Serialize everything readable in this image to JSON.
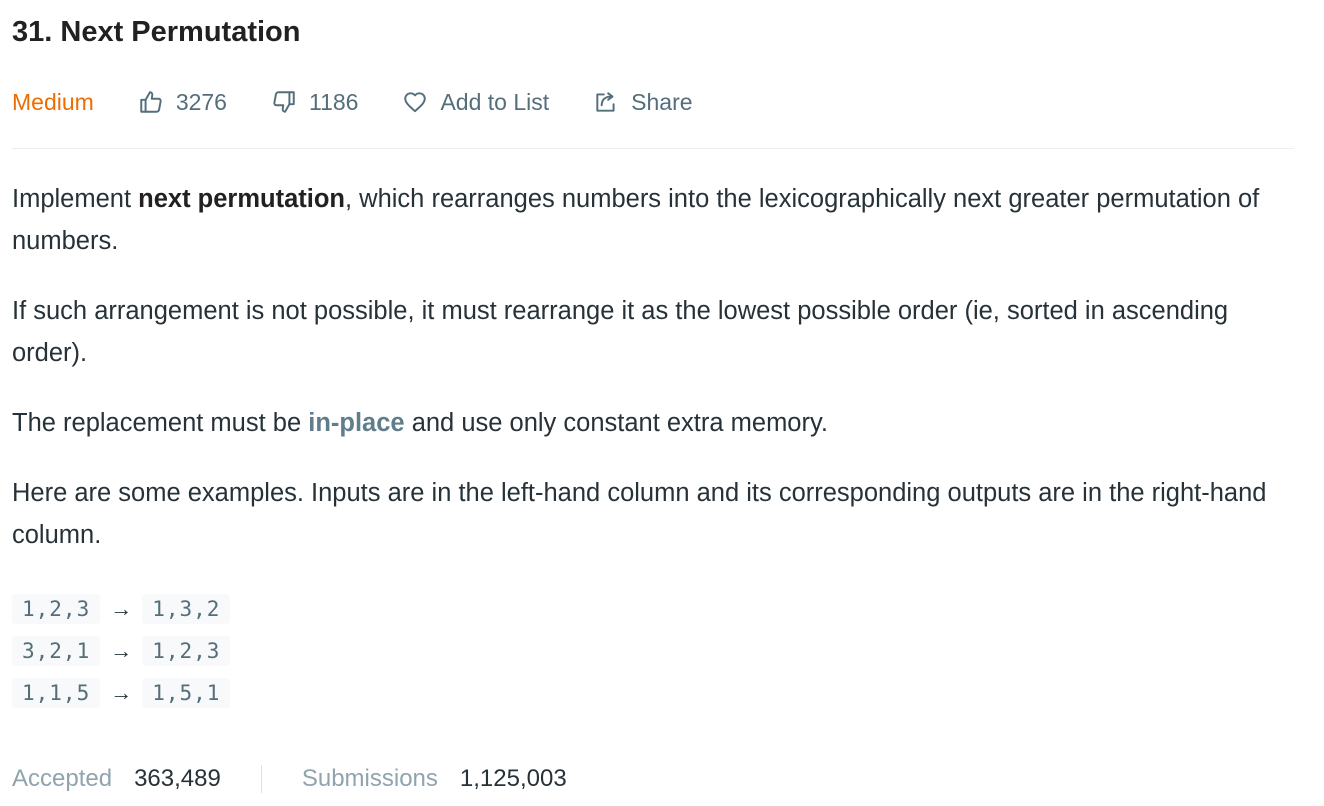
{
  "problem": {
    "title": "31. Next Permutation",
    "difficulty": "Medium",
    "likes": "3276",
    "dislikes": "1186",
    "add_to_list_label": "Add to List",
    "share_label": "Share"
  },
  "description": {
    "p1_pre": "Implement ",
    "p1_bold": "next permutation",
    "p1_post": ", which rearranges numbers into the lexicographically next greater permutation of numbers.",
    "p2": "If such arrangement is not possible, it must rearrange it as the lowest possible order (ie, sorted in ascending order).",
    "p3_pre": "The replacement must be ",
    "p3_link": "in-place",
    "p3_post": " and use only constant extra memory.",
    "p4": "Here are some examples. Inputs are in the left-hand column and its corresponding outputs are in the right-hand column."
  },
  "examples": [
    {
      "input": "1,2,3",
      "arrow": "→",
      "output": "1,3,2"
    },
    {
      "input": "3,2,1",
      "arrow": "→",
      "output": "1,2,3"
    },
    {
      "input": "1,1,5",
      "arrow": "→",
      "output": "1,5,1"
    }
  ],
  "stats": {
    "accepted_label": "Accepted",
    "accepted_value": "363,489",
    "submissions_label": "Submissions",
    "submissions_value": "1,125,003"
  },
  "colors": {
    "difficulty_medium": "#ef6c00",
    "link": "#607d8b",
    "muted": "#546e7a"
  },
  "icons": [
    "thumbs-up-icon",
    "thumbs-down-icon",
    "heart-icon",
    "share-icon"
  ]
}
